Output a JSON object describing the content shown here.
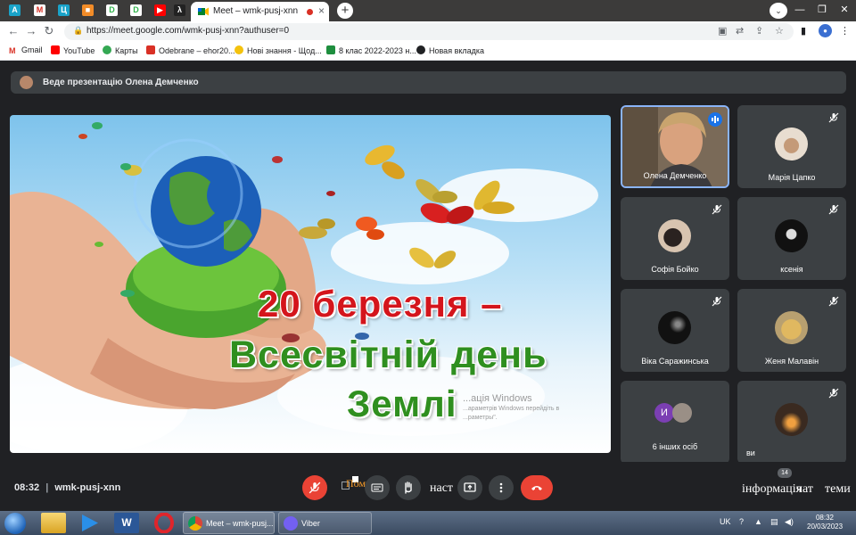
{
  "browser": {
    "active_tab_title": "Meet – wmk-pusj-xnn",
    "url": "https://meet.google.com/wmk-pusj-xnn?authuser=0",
    "bookmarks": [
      "Gmail",
      "YouTube",
      "Карты",
      "Odebrane – ehor20...",
      "Нові знання - Щод...",
      "8 клас 2022-2023 н...",
      "Новая вкладка"
    ]
  },
  "meet": {
    "presenter_text": "Веде презентацію Олена Демченко",
    "slide": {
      "line1": "20 березня –",
      "line2": "Всесвітній день",
      "line3": "Землі",
      "watermark1": "...ація Windows",
      "watermark2": "...араметрів Windows перейдіть в",
      "watermark3": "...раметры\"."
    },
    "participants": [
      {
        "name": "Олена Демченко"
      },
      {
        "name": "Марія Цапко"
      },
      {
        "name": "Софія Бойко"
      },
      {
        "name": "ксенія"
      },
      {
        "name": "Віка Саражинська"
      },
      {
        "name": "Женя Малавін"
      },
      {
        "name": "6 інших осіб",
        "initial": "И"
      },
      {
        "name": "ви"
      }
    ],
    "bottom": {
      "time": "08:32",
      "separator": "|",
      "meeting_code": "wmk-pusj-xnn",
      "caption_label": "Помилка",
      "settings_label": "наст",
      "info_label": "інформація",
      "chat_label": "чат",
      "themes_label": "теми",
      "people_count": "14"
    }
  },
  "taskbar": {
    "tasks": [
      "Meet – wmk-pusj...",
      "Viber"
    ],
    "lang": "UK",
    "time": "08:32",
    "date": "20/03/2023"
  }
}
